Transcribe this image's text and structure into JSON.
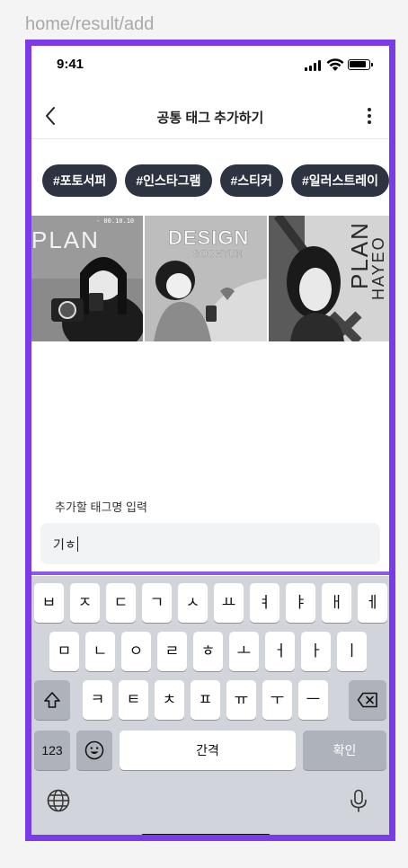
{
  "route": "home/result/add",
  "status": {
    "time": "9:41"
  },
  "nav": {
    "title": "공통 태그 추가하기"
  },
  "tags": [
    "#포토서퍼",
    "#인스타그램",
    "#스티커",
    "#일러스트레이"
  ],
  "gallery": [
    {
      "caption": "PLAN",
      "sub": "- 00.10.10"
    },
    {
      "caption": "DESIGN",
      "sub": "SOOHYUN"
    },
    {
      "caption": "PLAN",
      "sub": "HAYEO"
    }
  ],
  "form": {
    "label": "추가할 태그명 입력",
    "value": "기ㅎ"
  },
  "keyboard": {
    "row1": [
      "ㅂ",
      "ㅈ",
      "ㄷ",
      "ㄱ",
      "ㅅ",
      "ㅛ",
      "ㅕ",
      "ㅑ",
      "ㅐ",
      "ㅔ"
    ],
    "row2": [
      "ㅁ",
      "ㄴ",
      "ㅇ",
      "ㄹ",
      "ㅎ",
      "ㅗ",
      "ㅓ",
      "ㅏ",
      "ㅣ"
    ],
    "row3": [
      "ㅋ",
      "ㅌ",
      "ㅊ",
      "ㅍ",
      "ㅠ",
      "ㅜ",
      "ㅡ"
    ],
    "num_label": "123",
    "space_label": "간격",
    "confirm_label": "확인"
  },
  "icons": [
    "chevron-left-icon",
    "more-vertical-icon",
    "shift-icon",
    "backspace-icon",
    "emoji-icon",
    "globe-icon",
    "microphone-icon"
  ],
  "colors": {
    "accent": "#7a3be8",
    "tag_bg": "#2d3340"
  }
}
